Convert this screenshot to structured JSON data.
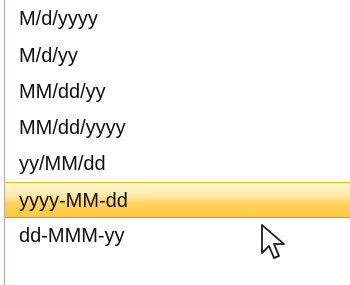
{
  "dropdown": {
    "items": [
      {
        "label": "M/d/yyyy"
      },
      {
        "label": "M/d/yy"
      },
      {
        "label": "MM/dd/yy"
      },
      {
        "label": "MM/dd/yyyy"
      },
      {
        "label": "yy/MM/dd"
      },
      {
        "label": "yyyy-MM-dd",
        "highlighted": true
      },
      {
        "label": "dd-MMM-yy"
      }
    ],
    "highlight_color": "#ffd35c"
  },
  "cursor": {
    "icon": "mouse-pointer-icon"
  }
}
